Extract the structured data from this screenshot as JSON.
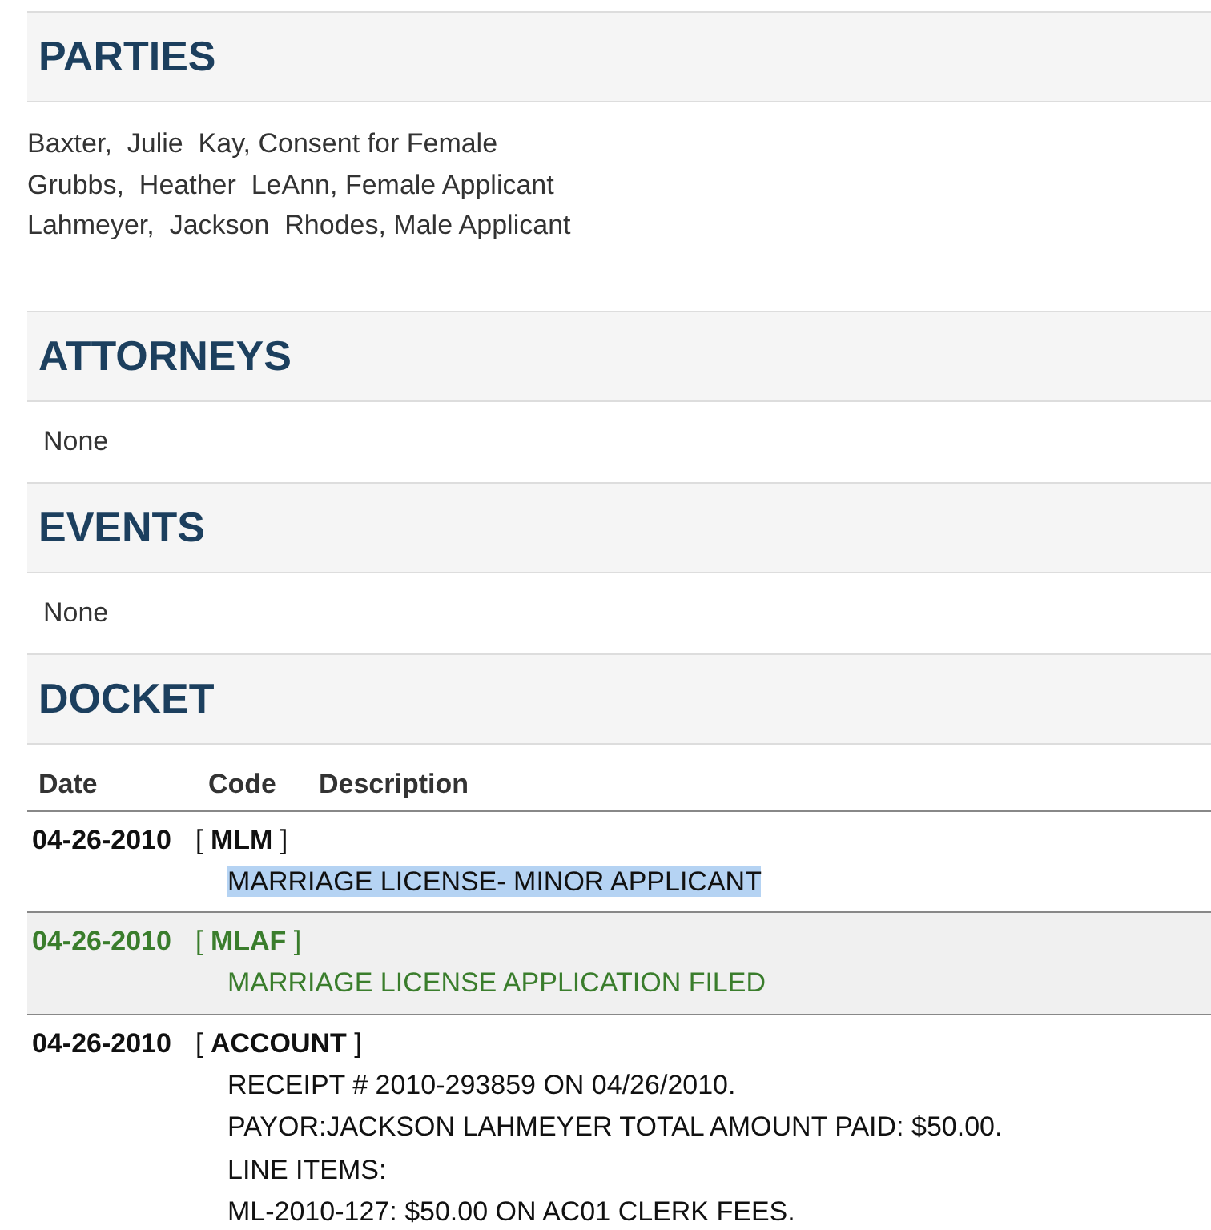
{
  "parties": {
    "title": "PARTIES",
    "items": [
      "Baxter,  Julie  Kay, Consent for Female",
      "Grubbs,  Heather  LeAnn, Female Applicant",
      "Lahmeyer,  Jackson  Rhodes, Male Applicant"
    ]
  },
  "attorneys": {
    "title": "ATTORNEYS",
    "text": "None"
  },
  "events": {
    "title": "EVENTS",
    "text": "None"
  },
  "docket": {
    "title": "DOCKET",
    "columns": [
      "Date",
      "Code",
      "Description"
    ],
    "rows": [
      {
        "date": "04-26-2010",
        "code": "[ **MLM** ]",
        "description": [
          "MARRIAGE LICENSE- MINOR APPLICANT"
        ],
        "color": "#111111",
        "shaded": false,
        "text_selected": true
      },
      {
        "date": "04-26-2010",
        "code": "[ **MLAF** ]",
        "description": [
          "MARRIAGE LICENSE APPLICATION FILED"
        ],
        "color": "#3a7d2c",
        "shaded": true,
        "text_selected": false
      },
      {
        "date": "04-26-2010",
        "code": "[ **ACCOUNT** ]",
        "description": [
          "RECEIPT # 2010-293859 ON 04/26/2010.",
          "PAYOR:JACKSON LAHMEYER TOTAL AMOUNT PAID: $50.00.",
          "LINE ITEMS:",
          "ML-2010-127: $50.00 ON AC01 CLERK FEES."
        ],
        "color": "#111111",
        "shaded": false,
        "text_selected": false
      }
    ]
  }
}
